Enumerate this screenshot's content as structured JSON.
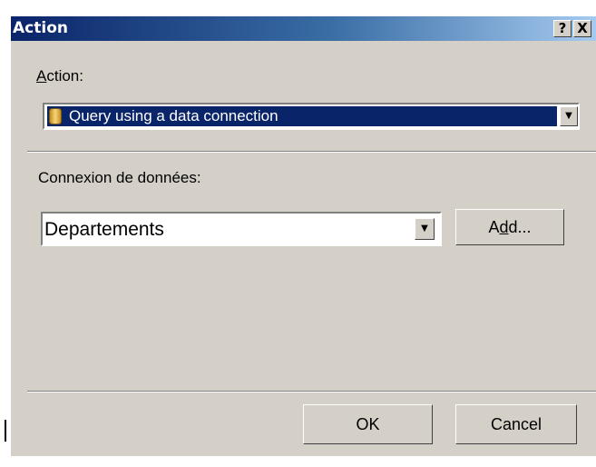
{
  "dialog": {
    "title": "Action",
    "help_label": "?",
    "close_label": "X",
    "action_label": "Action:",
    "action_label_mnemonic": "A",
    "action_label_rest": "ction:",
    "action_combo_value": "Query using a data connection",
    "connection_label": "Connexion de données:",
    "connection_combo_value": "Departements",
    "add_button_pre": "A",
    "add_button_mnemonic": "d",
    "add_button_post": "d...",
    "ok_label": "OK",
    "cancel_label": "Cancel",
    "dropdown_arrow": "▼"
  }
}
